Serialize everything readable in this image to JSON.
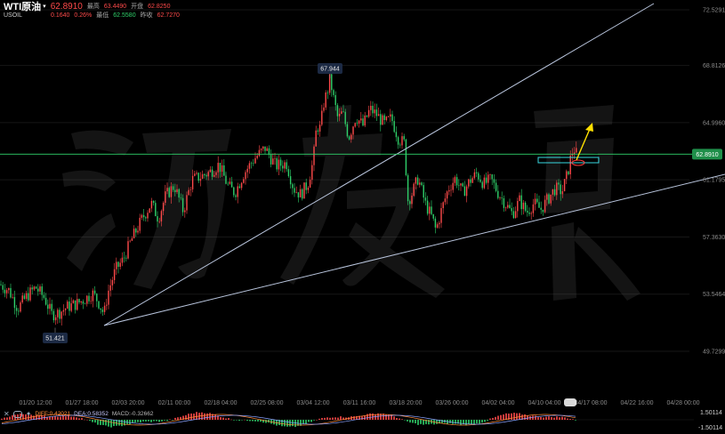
{
  "header": {
    "symbol": "WTI原油",
    "price": "62.8910",
    "code": "USOIL",
    "change": "0.1640",
    "change_pct": "0.26%",
    "high_label": "最高",
    "high": "63.4490",
    "open_label": "开盘",
    "open": "62.8250",
    "low_label": "最低",
    "low": "62.5580",
    "prev_label": "昨收",
    "prev": "62.7270"
  },
  "indicator": {
    "diff": "DIFF:0.42021",
    "dea": "DEA:0.58352",
    "macd": "MACD:-0.32662",
    "upper": "1.50114",
    "lower": "-1.50114"
  },
  "colors": {
    "up": "#ff4a4a",
    "down": "#2fd16a",
    "price_line": "#2fd16a",
    "trend": "#b8c4dc",
    "annotation": "#ffe000",
    "box": "#37d7e0"
  },
  "chart_data": {
    "type": "candlestick",
    "ylim": [
      49.7299,
      72.5291
    ],
    "y_ticks": [
      "72.5291",
      "68.8126",
      "64.9960",
      "61.1795",
      "57.3630",
      "53.5464",
      "49.7299"
    ],
    "x_tick_labels": [
      "01/20 12:00",
      "01/27 18:00",
      "02/03 20:00",
      "02/11 00:00",
      "02/18 04:00",
      "02/25 08:00",
      "03/04 12:00",
      "03/11 16:00",
      "03/18 20:00",
      "03/26 00:00",
      "04/02 04:00",
      "04/10 04:00",
      "04/17 08:00",
      "04/22 16:00",
      "04/28 00:00"
    ],
    "current_price": "62.8910",
    "annotations": {
      "low": "51.421",
      "high": "67.944"
    },
    "path": [
      [
        0,
        54.2
      ],
      [
        10,
        53.8
      ],
      [
        20,
        52.6
      ],
      [
        30,
        53.4
      ],
      [
        40,
        54.0
      ],
      [
        50,
        53.3
      ],
      [
        58,
        52.2
      ],
      [
        66,
        52.3
      ],
      [
        76,
        52.7
      ],
      [
        86,
        52.9
      ],
      [
        95,
        53.2
      ],
      [
        104,
        53.6
      ],
      [
        110,
        53.1
      ],
      [
        117,
        52.2
      ],
      [
        121,
        53.6
      ],
      [
        130,
        55.2
      ],
      [
        138,
        55.8
      ],
      [
        148,
        57.2
      ],
      [
        160,
        58.6
      ],
      [
        170,
        59.6
      ],
      [
        178,
        58.6
      ],
      [
        186,
        60.1
      ],
      [
        196,
        60.8
      ],
      [
        206,
        59.1
      ],
      [
        216,
        61.2
      ],
      [
        226,
        61.4
      ],
      [
        236,
        61.7
      ],
      [
        246,
        62.2
      ],
      [
        256,
        60.8
      ],
      [
        264,
        60.3
      ],
      [
        274,
        61.6
      ],
      [
        286,
        62.6
      ],
      [
        298,
        63.3
      ],
      [
        310,
        62.1
      ],
      [
        322,
        62.3
      ],
      [
        330,
        60.6
      ],
      [
        338,
        60.2
      ],
      [
        346,
        60.9
      ],
      [
        352,
        62.4
      ],
      [
        356,
        64.8
      ],
      [
        360,
        64.6
      ],
      [
        364,
        66.3
      ],
      [
        368,
        67.1
      ],
      [
        371,
        67.94
      ],
      [
        375,
        66.6
      ],
      [
        380,
        65.2
      ],
      [
        385,
        65.7
      ],
      [
        392,
        64.0
      ],
      [
        400,
        65.4
      ],
      [
        408,
        64.8
      ],
      [
        416,
        65.9
      ],
      [
        424,
        65.5
      ],
      [
        432,
        64.9
      ],
      [
        440,
        65.3
      ],
      [
        448,
        63.9
      ],
      [
        455,
        63.6
      ],
      [
        458,
        59.8
      ],
      [
        462,
        60.1
      ],
      [
        470,
        61.3
      ],
      [
        478,
        59.6
      ],
      [
        486,
        58.6
      ],
      [
        490,
        57.8
      ],
      [
        496,
        59.1
      ],
      [
        504,
        60.6
      ],
      [
        512,
        61.3
      ],
      [
        520,
        60.3
      ],
      [
        528,
        61.1
      ],
      [
        536,
        61.6
      ],
      [
        544,
        60.9
      ],
      [
        552,
        61.2
      ],
      [
        560,
        60.3
      ],
      [
        568,
        59.6
      ],
      [
        576,
        58.9
      ],
      [
        584,
        59.8
      ],
      [
        592,
        59.0
      ],
      [
        600,
        59.6
      ],
      [
        608,
        59.2
      ],
      [
        616,
        59.9
      ],
      [
        624,
        60.6
      ],
      [
        632,
        60.4
      ],
      [
        638,
        61.6
      ],
      [
        642,
        62.8
      ],
      [
        645,
        63.3
      ],
      [
        648,
        62.9
      ]
    ]
  }
}
